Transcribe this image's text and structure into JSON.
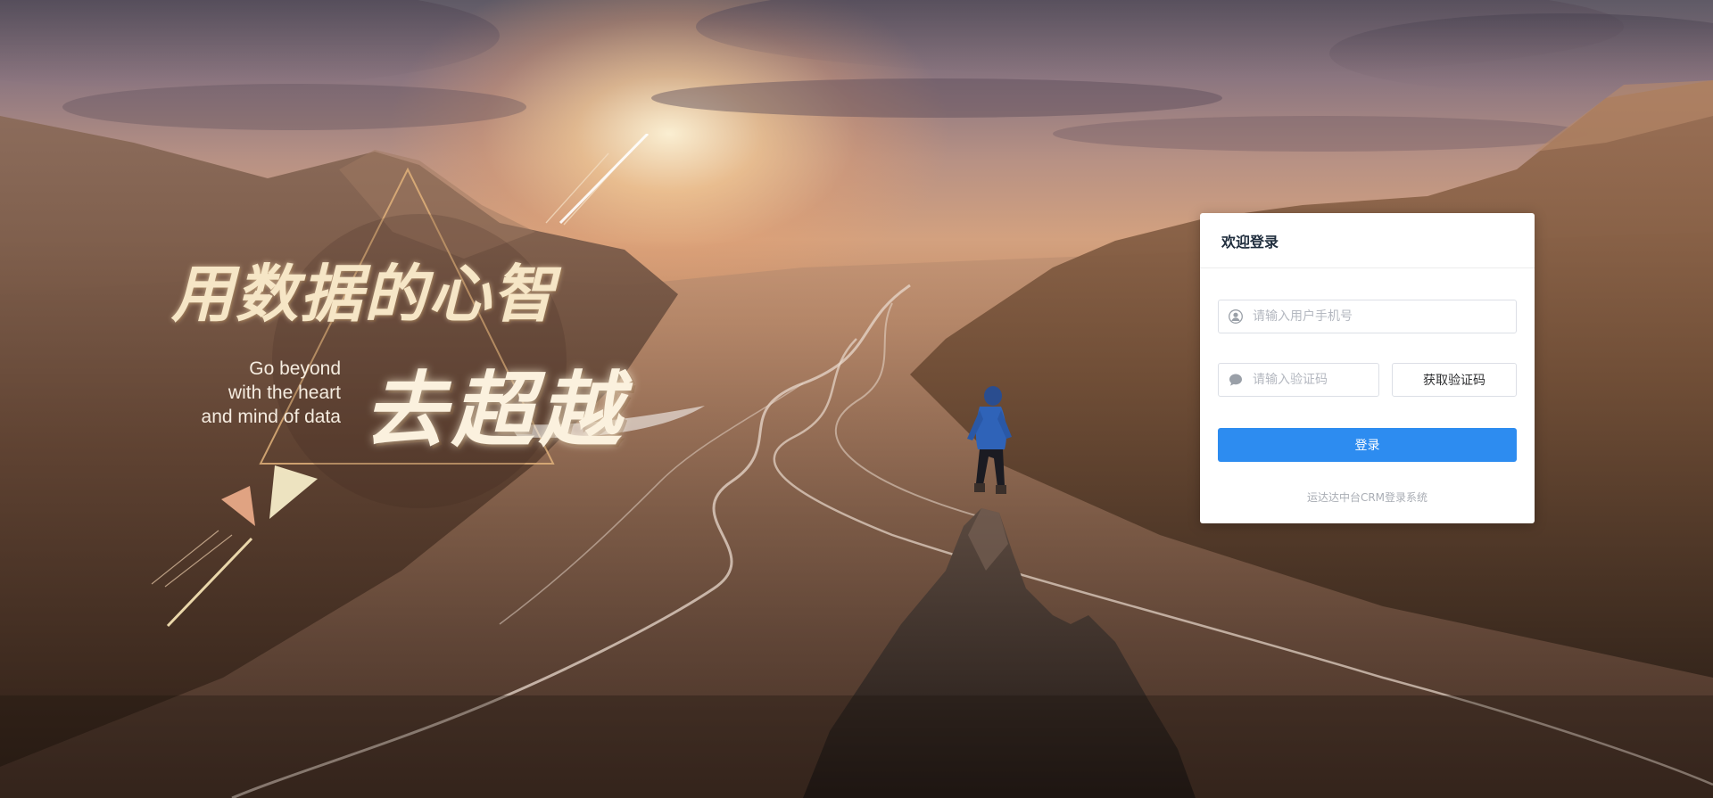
{
  "hero": {
    "slogan_line1": "用数据的心智",
    "slogan_line2": "去超越",
    "english_lines": [
      "Go beyond",
      "with the heart",
      "and mind of data"
    ]
  },
  "login": {
    "title": "欢迎登录",
    "phone_placeholder": "请输入用户手机号",
    "code_placeholder": "请输入验证码",
    "get_code_label": "获取验证码",
    "submit_label": "登录",
    "footer_text": "运达达中台CRM登录系统"
  },
  "icons": {
    "phone_field": "user-icon",
    "code_field": "chat-bubble-icon"
  },
  "colors": {
    "primary": "#2d8cf0",
    "card_bg": "#ffffff",
    "slogan": "#f6e6c6"
  }
}
